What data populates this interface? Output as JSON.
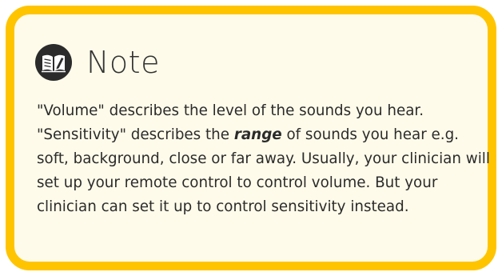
{
  "note": {
    "title": "Note",
    "icon": "book-icon",
    "border_color": "#ffc400",
    "background_color": "#fffbea",
    "text_before": "\"Volume\" describes the level of the sounds you hear. \"Sensitivity\" describes the ",
    "emphasis": "range",
    "text_after": " of sounds you hear e.g. soft, background, close or far away. Usually, your clinician will set up your remote control to control volume. But your clinician can set it up to control sensitivity instead."
  }
}
